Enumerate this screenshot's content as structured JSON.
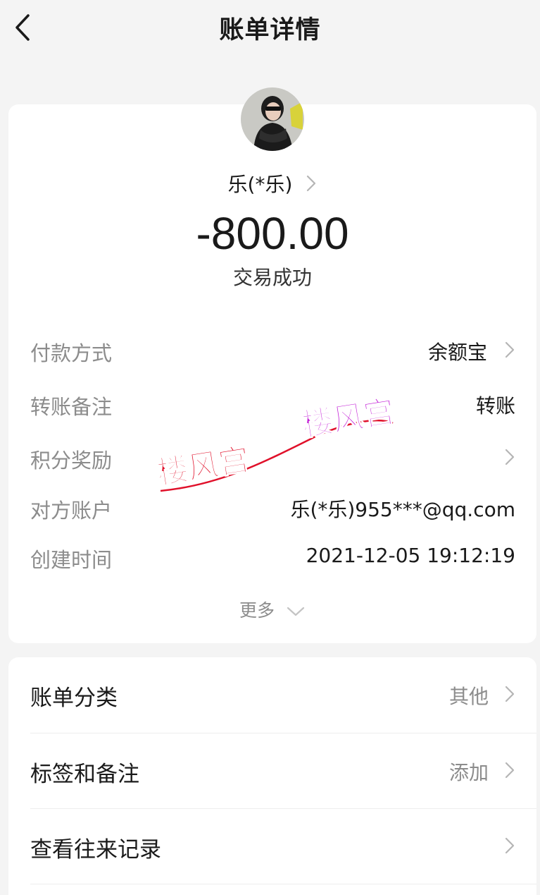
{
  "header": {
    "title": "账单详情",
    "back_icon": "chevron-left-icon"
  },
  "payee": {
    "name": "乐(*乐)",
    "avatar_icon": "avatar-photo"
  },
  "amount": "-800.00",
  "status": "交易成功",
  "details": [
    {
      "label": "付款方式",
      "value": "余额宝",
      "has_chevron": true
    },
    {
      "label": "转账备注",
      "value": "转账",
      "has_chevron": false
    },
    {
      "label": "积分奖励",
      "value": "",
      "has_chevron": true
    },
    {
      "label": "对方账户",
      "value": "乐(*乐)955***@qq.com",
      "has_chevron": false
    },
    {
      "label": "创建时间",
      "value": "2021-12-05 19:12:19",
      "has_chevron": false
    }
  ],
  "more": {
    "label": "更多",
    "icon": "chevron-down-icon"
  },
  "watermark": {
    "text_left": "楼风宫",
    "text_right": "楼风宫"
  },
  "actions": [
    {
      "label": "账单分类",
      "value": "其他"
    },
    {
      "label": "标签和备注",
      "value": "添加"
    },
    {
      "label": "查看往来记录",
      "value": ""
    }
  ],
  "colors": {
    "background": "#f4f4f4",
    "card": "#ffffff",
    "muted_text": "#8c8c8c",
    "watermark_red": "#e0102a",
    "watermark_purple": "#c21bd6"
  }
}
